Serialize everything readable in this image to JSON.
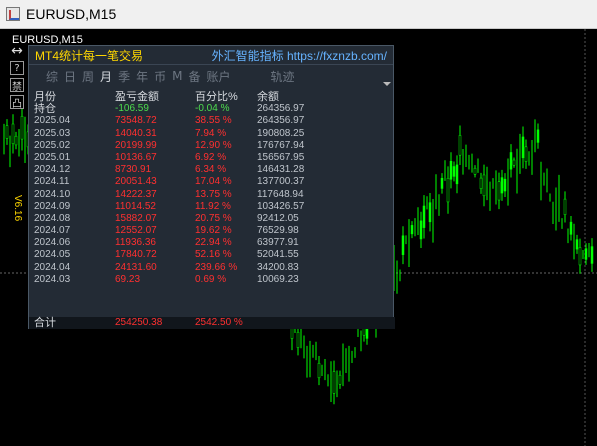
{
  "window": {
    "title": "EURUSD,M15",
    "app_icon": "chart-window-icon"
  },
  "chart": {
    "symbol_label": "EURUSD,M15",
    "candle_color": "#00ff00",
    "background": "#000000"
  },
  "toolbox": {
    "version": "V6.16",
    "buttons": [
      "↔",
      "?",
      "禁",
      "凸"
    ]
  },
  "panel": {
    "title": "MT4统计每一笔交易",
    "site": "外汇智能指标 https://fxznzb.com/",
    "tabs": [
      "综",
      "日",
      "周",
      "月",
      "季",
      "年",
      "币",
      "M",
      "备",
      "账户",
      "轨迹"
    ],
    "active_tab": "月",
    "headers": [
      "月份",
      "盈亏金额",
      "百分比%",
      "余额"
    ],
    "holding": {
      "label": "持仓",
      "pnl": "-106.59",
      "pct": "-0.04 %",
      "balance": "264356.97"
    },
    "rows": [
      {
        "month": "2025.04",
        "pnl": "73548.72",
        "pct": "38.55 %",
        "balance": "264356.97"
      },
      {
        "month": "2025.03",
        "pnl": "14040.31",
        "pct": "7.94 %",
        "balance": "190808.25"
      },
      {
        "month": "2025.02",
        "pnl": "20199.99",
        "pct": "12.90 %",
        "balance": "176767.94"
      },
      {
        "month": "2025.01",
        "pnl": "10136.67",
        "pct": "6.92 %",
        "balance": "156567.95"
      },
      {
        "month": "2024.12",
        "pnl": "8730.91",
        "pct": "6.34 %",
        "balance": "146431.28"
      },
      {
        "month": "2024.11",
        "pnl": "20051.43",
        "pct": "17.04 %",
        "balance": "137700.37"
      },
      {
        "month": "2024.10",
        "pnl": "14222.37",
        "pct": "13.75 %",
        "balance": "117648.94"
      },
      {
        "month": "2024.09",
        "pnl": "11014.52",
        "pct": "11.92 %",
        "balance": "103426.57"
      },
      {
        "month": "2024.08",
        "pnl": "15882.07",
        "pct": "20.75 %",
        "balance": "92412.05"
      },
      {
        "month": "2024.07",
        "pnl": "12552.07",
        "pct": "19.62 %",
        "balance": "76529.98"
      },
      {
        "month": "2024.06",
        "pnl": "11936.36",
        "pct": "22.94 %",
        "balance": "63977.91"
      },
      {
        "month": "2024.05",
        "pnl": "17840.72",
        "pct": "52.16 %",
        "balance": "52041.55"
      },
      {
        "month": "2024.04",
        "pnl": "24131.60",
        "pct": "239.66 %",
        "balance": "34200.83"
      },
      {
        "month": "2024.03",
        "pnl": "69.23",
        "pct": "0.69 %",
        "balance": "10069.23"
      }
    ],
    "total": {
      "label": "合计",
      "pnl": "254250.38",
      "pct": "2542.50 %"
    }
  },
  "colors": {
    "profit": "#ff3030",
    "holding": "#4ddc4d",
    "panel_bg": "#232b35",
    "title": "#ffd700",
    "link": "#66b3ff"
  }
}
